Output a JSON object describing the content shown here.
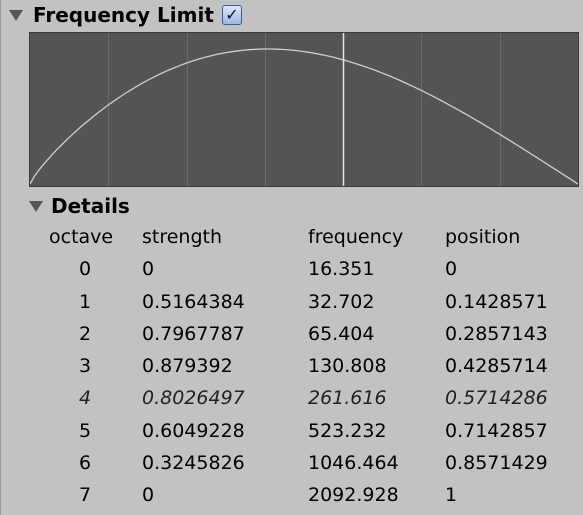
{
  "header": {
    "title": "Frequency Limit",
    "checked": true,
    "check_glyph": "✓"
  },
  "details": {
    "title": "Details",
    "columns": {
      "octave": "octave",
      "strength": "strength",
      "frequency": "frequency",
      "position": "position"
    },
    "rows": [
      {
        "octave": "0",
        "strength": "0",
        "frequency": "16.351",
        "position": "0",
        "highlighted": false
      },
      {
        "octave": "1",
        "strength": "0.5164384",
        "frequency": "32.702",
        "position": "0.1428571",
        "highlighted": false
      },
      {
        "octave": "2",
        "strength": "0.7967787",
        "frequency": "65.404",
        "position": "0.2857143",
        "highlighted": false
      },
      {
        "octave": "3",
        "strength": "0.879392",
        "frequency": "130.808",
        "position": "0.4285714",
        "highlighted": false
      },
      {
        "octave": "4",
        "strength": "0.8026497",
        "frequency": "261.616",
        "position": "0.5714286",
        "highlighted": true
      },
      {
        "octave": "5",
        "strength": "0.6049228",
        "frequency": "523.232",
        "position": "0.7142857",
        "highlighted": false
      },
      {
        "octave": "6",
        "strength": "0.3245826",
        "frequency": "1046.464",
        "position": "0.8571429",
        "highlighted": false
      },
      {
        "octave": "7",
        "strength": "0",
        "frequency": "2092.928",
        "position": "1",
        "highlighted": false
      }
    ]
  },
  "graph": {
    "curve_color": "#cfcfcf",
    "grid_color": "#6a6a6a",
    "marker_color": "#e6e6e6",
    "marker_position": 0.5714286,
    "peak_strength": 0.88
  }
}
